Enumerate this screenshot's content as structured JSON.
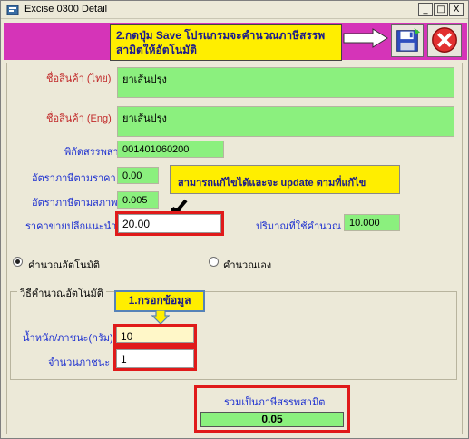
{
  "window": {
    "title": "Excise 0300 Detail",
    "controls": {
      "minimize": "_",
      "maximize": "□",
      "close": "X"
    }
  },
  "header": {
    "callout_text": "2.กดปุ่ม Save โปรแกรมจะคำนวณภาษีสรรพสามิตให้อัตโนมัติ",
    "save_icon": "floppy-disk-icon",
    "cancel_icon": "cancel-x-icon",
    "background_color": "#d534b8",
    "callout_color": "#ffee00"
  },
  "form": {
    "product_name_th": {
      "label": "ชื่อสินค้า (ไทย)",
      "value": "ยาเส้นปรุง"
    },
    "product_name_en": {
      "label": "ชื่อสินค้า (Eng)",
      "value": "ยาเส้นปรุง"
    },
    "excise_code": {
      "label": "พิกัดสรรพสามิต",
      "value": "001401060200"
    },
    "ad_valorem_rate": {
      "label": "อัตราภาษีตามราคา",
      "value": "0.00"
    },
    "specific_rate": {
      "label": "อัตราภาษีตามสภาพ",
      "value": "0.005"
    },
    "note": "สามารถแก้ไขได้และจะ update ตามที่แก้ไข",
    "retail_price": {
      "label": "ราคาขายปลีกแนะนำ",
      "value": "20.00"
    },
    "quantity_used": {
      "label": "ปริมาณที่ใช้คำนวณ",
      "value": "10.000"
    }
  },
  "calc_mode": {
    "auto_label": "คำนวณอัตโนมัติ",
    "manual_label": "คำนวณเอง",
    "selected": "auto"
  },
  "auto_group": {
    "title": "วิธีคำนวณอัตโนมัติ",
    "step1_label": "1.กรอกข้อมูล",
    "weight": {
      "label": "น้ำหนัก/ภาชนะ(กรัม)",
      "value": "10"
    },
    "containers": {
      "label": "จำนวนภาชนะ",
      "value": "1"
    }
  },
  "total": {
    "label": "รวมเป็นภาษีสรรพสามิต",
    "value": "0.05"
  }
}
